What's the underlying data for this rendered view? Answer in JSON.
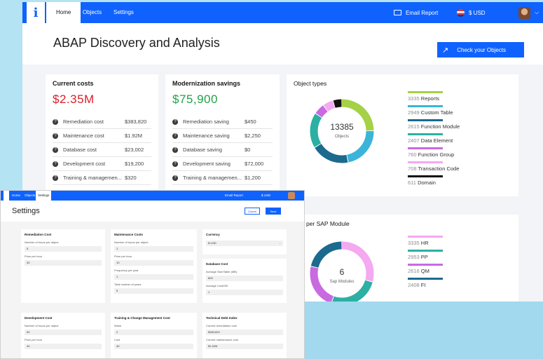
{
  "nav": {
    "tabs": [
      "Home",
      "Objects",
      "Settings"
    ],
    "email_report": "Email Report",
    "currency": "$ USD",
    "avatar_caret": "⌵"
  },
  "header": {
    "title": "ABAP Discovery and Analysis",
    "check_button": "Check your Objects"
  },
  "current_costs": {
    "title": "Current costs",
    "total": "$2.35M",
    "rows": [
      {
        "label": "Remediation cost",
        "value": "$383,820"
      },
      {
        "label": "Maintenance cost",
        "value": "$1.92M"
      },
      {
        "label": "Database cost",
        "value": "$23,002"
      },
      {
        "label": "Development cost",
        "value": "$19,200"
      },
      {
        "label": "Training & managemen...",
        "value": "$320"
      }
    ]
  },
  "savings": {
    "title": "Modernization savings",
    "total": "$75,900",
    "rows": [
      {
        "label": "Remediation saving",
        "value": "$450"
      },
      {
        "label": "Maintenance saving",
        "value": "$2,250"
      },
      {
        "label": "Database saving",
        "value": "$0"
      },
      {
        "label": "Development saving",
        "value": "$72,000"
      },
      {
        "label": "Training & managemen...",
        "value": "$1,200"
      }
    ]
  },
  "object_types": {
    "title": "Object types",
    "center_value": "13385",
    "center_label": "Objects",
    "items": [
      {
        "count": "3335",
        "name": "Reports",
        "color": "#a5d146"
      },
      {
        "count": "2949",
        "name": "Custom Table",
        "color": "#3ab4d9"
      },
      {
        "count": "2615",
        "name": "Function Module",
        "color": "#1c6a8e"
      },
      {
        "count": "2407",
        "name": "Data Element",
        "color": "#2bb0a3"
      },
      {
        "count": "760",
        "name": "Function Group",
        "color": "#c86ae0"
      },
      {
        "count": "708",
        "name": "Transaction Code",
        "color": "#f4a9f0"
      },
      {
        "count": "611",
        "name": "Domain",
        "color": "#111111"
      }
    ]
  },
  "modules": {
    "title": "ects per SAP Module",
    "center_value": "6",
    "center_label": "Sap Modules",
    "items": [
      {
        "count": "3335",
        "name": "HR",
        "color": "#f4a9f0"
      },
      {
        "count": "2953",
        "name": "PP",
        "color": "#2bb0a3"
      },
      {
        "count": "2616",
        "name": "QM",
        "color": "#c86ae0"
      },
      {
        "count": "2408",
        "name": "FI",
        "color": "#1c6a8e"
      }
    ]
  },
  "settings": {
    "nav_tabs": [
      "Home",
      "Objects",
      "Settings"
    ],
    "nav_email": "Email Report",
    "nav_currency": "$ USD",
    "title": "Settings",
    "cancel": "Cancel",
    "save": "Save",
    "remediation": {
      "title": "Remediation Cost",
      "f1": "Number of hours per object",
      "v1": "5",
      "f2": "Price per hour",
      "v2": "30"
    },
    "maintenance": {
      "title": "Maintenance Costs",
      "f1": "Number of hours per object",
      "v1": "1",
      "f2": "Price per hour",
      "v2": "10",
      "f3": "Frequency per year",
      "v3": "1",
      "f4": "Total number of years",
      "v4": "5"
    },
    "currency": {
      "title": "Currency",
      "value": "$ USD"
    },
    "database": {
      "title": "Database Cost",
      "f1": "Average Size/Table (MB)",
      "v1": "800",
      "f2": "Average Cost/GB",
      "v2": "1"
    },
    "development": {
      "title": "Development Cost",
      "f1": "Number of hours per object",
      "v1": "50",
      "f2": "Price per hour",
      "v2": "40"
    },
    "training": {
      "title": "Training & Change Management Cost",
      "f1": "Week",
      "v1": "2",
      "f2": "Cost",
      "v2": "40"
    },
    "debt": {
      "title": "Technical Debt Index",
      "f1": "Current remediation cost",
      "v1": "$383,820",
      "f2": "Current maintenance cost",
      "v2": "$1.92M"
    }
  }
}
